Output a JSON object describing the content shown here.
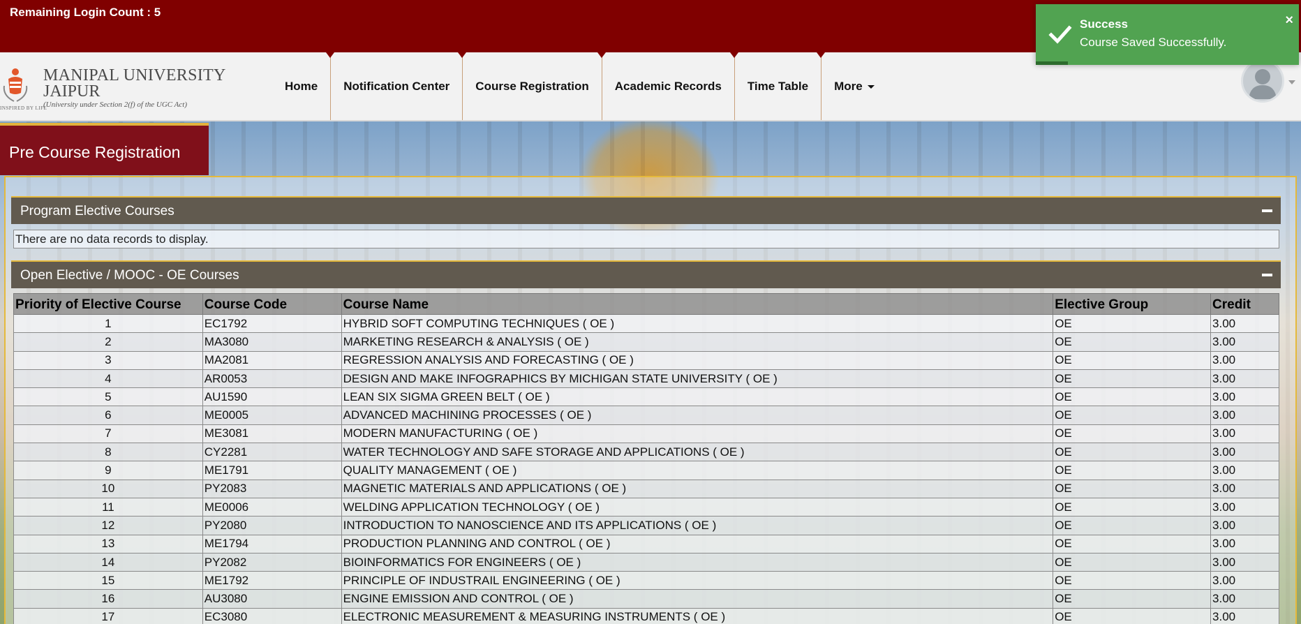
{
  "header": {
    "login_count": "Remaining Login Count : 5"
  },
  "logo": {
    "line1": "MANIPAL UNIVERSITY",
    "line2": "JAIPUR",
    "line3": "(University under Section 2(f) of the UGC Act)",
    "tagline": "INSPIRED BY LIFE"
  },
  "nav": {
    "items": [
      {
        "label": "Home"
      },
      {
        "label": "Notification Center"
      },
      {
        "label": "Course Registration"
      },
      {
        "label": "Academic Records"
      },
      {
        "label": "Time Table"
      },
      {
        "label": "More"
      }
    ]
  },
  "toast": {
    "title": "Success",
    "message": "Course Saved Successfully.",
    "close": "×",
    "color": "#51a351"
  },
  "page": {
    "title": "Pre Course Registration"
  },
  "sections": {
    "program_elective": {
      "title": "Program Elective Courses",
      "empty_message": "There are no data records to display."
    },
    "open_elective": {
      "title": "Open Elective / MOOC - OE Courses",
      "columns": [
        "Priority of Elective Course",
        "Course Code",
        "Course Name",
        "Elective Group",
        "Credit"
      ],
      "rows": [
        {
          "priority": "1",
          "code": "EC1792",
          "name": "HYBRID SOFT COMPUTING TECHNIQUES ( OE )",
          "group": "OE",
          "credit": "3.00"
        },
        {
          "priority": "2",
          "code": "MA3080",
          "name": "MARKETING RESEARCH & ANALYSIS ( OE )",
          "group": "OE",
          "credit": "3.00"
        },
        {
          "priority": "3",
          "code": "MA2081",
          "name": "REGRESSION ANALYSIS AND FORECASTING ( OE )",
          "group": "OE",
          "credit": "3.00"
        },
        {
          "priority": "4",
          "code": "AR0053",
          "name": "DESIGN AND MAKE INFOGRAPHICS BY MICHIGAN STATE UNIVERSITY ( OE )",
          "group": "OE",
          "credit": "3.00"
        },
        {
          "priority": "5",
          "code": "AU1590",
          "name": "LEAN SIX SIGMA GREEN BELT ( OE )",
          "group": "OE",
          "credit": "3.00"
        },
        {
          "priority": "6",
          "code": "ME0005",
          "name": "ADVANCED MACHINING PROCESSES ( OE )",
          "group": "OE",
          "credit": "3.00"
        },
        {
          "priority": "7",
          "code": "ME3081",
          "name": "MODERN MANUFACTURING ( OE )",
          "group": "OE",
          "credit": "3.00"
        },
        {
          "priority": "8",
          "code": "CY2281",
          "name": "WATER TECHNOLOGY AND SAFE STORAGE AND APPLICATIONS ( OE )",
          "group": "OE",
          "credit": "3.00"
        },
        {
          "priority": "9",
          "code": "ME1791",
          "name": "QUALITY MANAGEMENT ( OE )",
          "group": "OE",
          "credit": "3.00"
        },
        {
          "priority": "10",
          "code": "PY2083",
          "name": "MAGNETIC MATERIALS AND APPLICATIONS ( OE )",
          "group": "OE",
          "credit": "3.00"
        },
        {
          "priority": "11",
          "code": "ME0006",
          "name": "WELDING APPLICATION TECHNOLOGY ( OE )",
          "group": "OE",
          "credit": "3.00"
        },
        {
          "priority": "12",
          "code": "PY2080",
          "name": "INTRODUCTION TO NANOSCIENCE AND ITS APPLICATIONS ( OE )",
          "group": "OE",
          "credit": "3.00"
        },
        {
          "priority": "13",
          "code": "ME1794",
          "name": "PRODUCTION PLANNING AND CONTROL ( OE )",
          "group": "OE",
          "credit": "3.00"
        },
        {
          "priority": "14",
          "code": "PY2082",
          "name": "BIOINFORMATICS FOR ENGINEERS ( OE )",
          "group": "OE",
          "credit": "3.00"
        },
        {
          "priority": "15",
          "code": "ME1792",
          "name": "PRINCIPLE OF INDUSTRAIL ENGINEERING ( OE )",
          "group": "OE",
          "credit": "3.00"
        },
        {
          "priority": "16",
          "code": "AU3080",
          "name": "ENGINE EMISSION AND CONTROL ( OE )",
          "group": "OE",
          "credit": "3.00"
        },
        {
          "priority": "17",
          "code": "EC3080",
          "name": "ELECTRONIC MEASUREMENT & MEASURING INSTRUMENTS ( OE )",
          "group": "OE",
          "credit": "3.00"
        }
      ]
    }
  },
  "colors": {
    "topbar": "#800000",
    "title_tab": "#80101a",
    "section_header": "#615a4f",
    "accent_gold": "#e5b93b"
  },
  "icons": {
    "toast": "check-icon",
    "close": "close-icon",
    "collapse": "minus-icon",
    "avatar": "user-avatar-icon",
    "dropdown": "caret-down-icon"
  }
}
